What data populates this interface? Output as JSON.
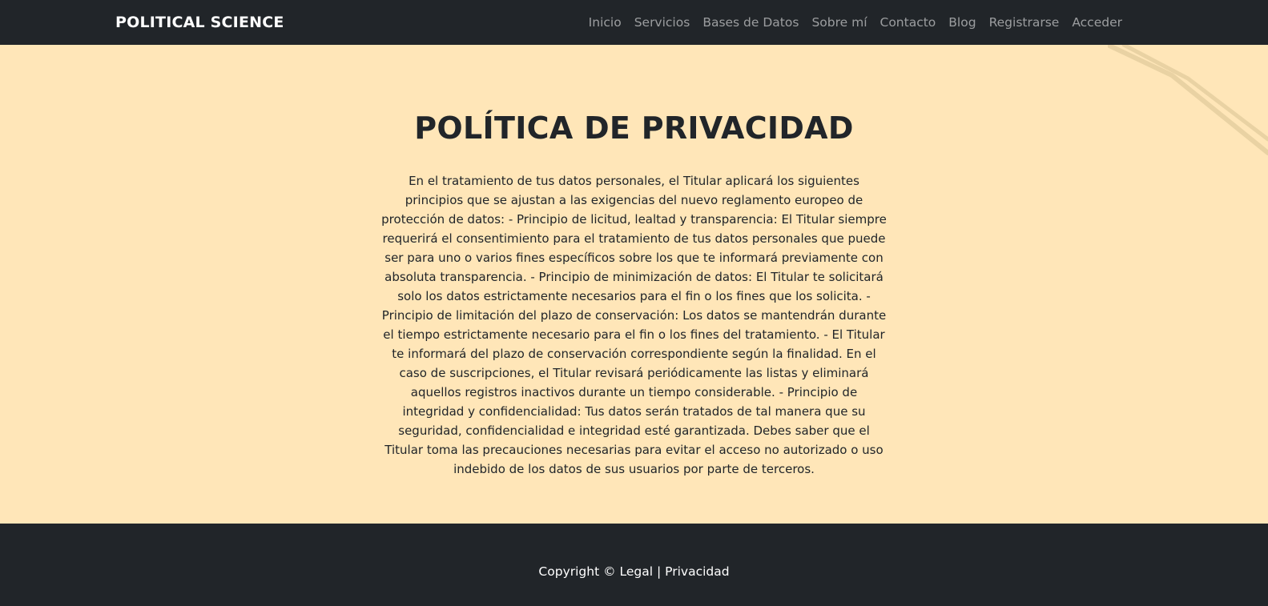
{
  "navbar": {
    "brand": "POLITICAL SCIENCE",
    "links": [
      "Inicio",
      "Servicios",
      "Bases de Datos",
      "Sobre mí",
      "Contacto",
      "Blog",
      "Registrarse",
      "Acceder"
    ]
  },
  "main": {
    "title": "POLÍTICA DE PRIVACIDAD",
    "paragraph": "En el tratamiento de tus datos personales, el Titular aplicará los siguientes principios que se ajustan a las exigencias del nuevo reglamento europeo de protección de datos: - Principio de licitud, lealtad y transparencia: El Titular siempre requerirá el consentimiento para el tratamiento de tus datos personales que puede ser para uno o varios fines específicos sobre los que te informará previamente con absoluta transparencia. - Principio de minimización de datos: El Titular te solicitará solo los datos estrictamente necesarios para el fin o los fines que los solicita. - Principio de limitación del plazo de conservación: Los datos se mantendrán durante el tiempo estrictamente necesario para el fin o los fines del tratamiento. - El Titular te informará del plazo de conservación correspondiente según la finalidad. En el caso de suscripciones, el Titular revisará periódicamente las listas y eliminará aquellos registros inactivos durante un tiempo considerable. - Principio de integridad y confidencialidad: Tus datos serán tratados de tal manera que su seguridad, confidencialidad e integridad esté garantizada. Debes saber que el Titular toma las precauciones necesarias para evitar el acceso no autorizado o uso indebido de los datos de sus usuarios por parte de terceros."
  },
  "footer": {
    "prefix": "Copyright © ",
    "legal": "Legal",
    "separator": " | ",
    "privacy": "Privacidad"
  },
  "colors": {
    "navbar_bg": "#212529",
    "page_bg": "#ffe6b8",
    "nav_link": "rgba(255,255,255,0.55)",
    "text": "#212529"
  }
}
